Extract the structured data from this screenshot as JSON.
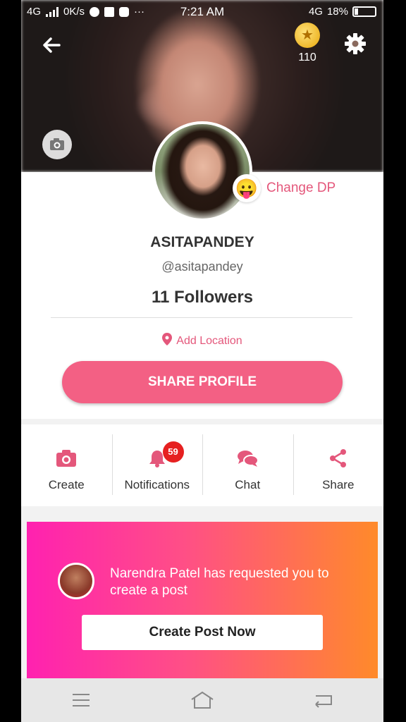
{
  "status_bar": {
    "network": "4G",
    "speed": "0K/s",
    "time": "7:21 AM",
    "network_right": "4G",
    "battery": "18%"
  },
  "header": {
    "coin_count": "110"
  },
  "profile": {
    "change_dp_label": "Change DP",
    "change_dp_emoji": "😛",
    "display_name": "ASITAPANDEY",
    "handle": "@asitapandey",
    "followers": "11 Followers",
    "add_location": "Add Location",
    "share_profile_label": "SHARE PROFILE"
  },
  "actions": [
    {
      "label": "Create",
      "icon": "camera-icon"
    },
    {
      "label": "Notifications",
      "icon": "bell-icon",
      "badge": "59"
    },
    {
      "label": "Chat",
      "icon": "chat-icon"
    },
    {
      "label": "Share",
      "icon": "share-icon"
    }
  ],
  "request_banner": {
    "message": "Narendra Patel has requested you to create a post",
    "button_label": "Create Post Now"
  },
  "colors": {
    "accent": "#f36084",
    "accent_text": "#e4577b",
    "badge": "#e62020",
    "banner_start": "#ff21b0",
    "banner_end": "#ff8a2a"
  }
}
